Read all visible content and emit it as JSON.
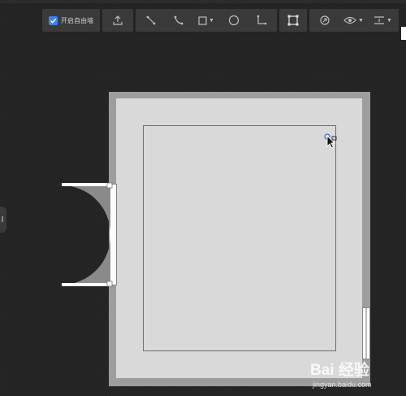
{
  "toolbar": {
    "snap_checkbox": {
      "label": "开启自由墙",
      "checked": true
    },
    "buttons": [
      {
        "name": "upload-icon"
      },
      {
        "name": "straight-wall-icon"
      },
      {
        "name": "curve-wall-icon"
      },
      {
        "name": "rectangle-tool-icon",
        "has_dropdown": true
      },
      {
        "name": "circle-tool-icon"
      },
      {
        "name": "dimension-tool-icon"
      },
      {
        "name": "room-select-icon",
        "active": true
      },
      {
        "name": "3d-view-icon"
      },
      {
        "name": "visibility-eye-icon",
        "has_dropdown": true
      },
      {
        "name": "align-icon",
        "has_dropdown": true
      }
    ]
  },
  "colors": {
    "checkbox_accent": "#3b82f6",
    "wall": "#9d9d9d",
    "floor": "#d9d9d9",
    "door_swing": "#8a8a8a"
  },
  "watermark": {
    "logo": "Bai 经验",
    "site": "jingyan.baidu.com"
  }
}
